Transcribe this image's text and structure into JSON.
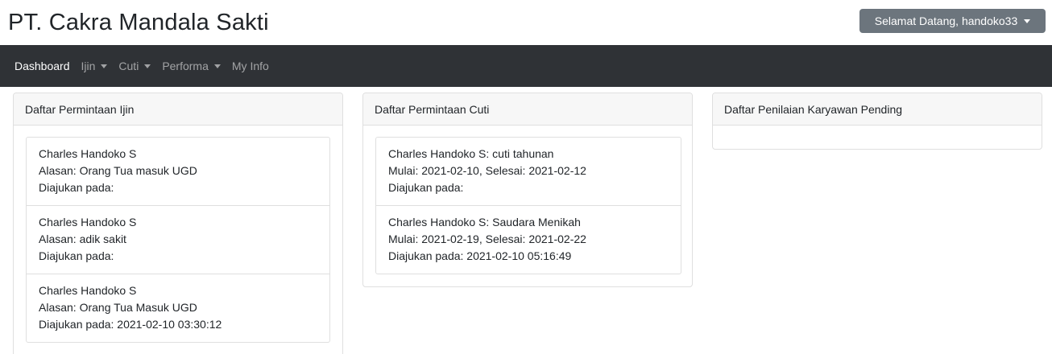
{
  "header": {
    "brand": "PT. Cakra Mandala Sakti",
    "user_menu_label": "Selamat Datang, handoko33"
  },
  "navbar": {
    "items": [
      {
        "label": "Dashboard"
      },
      {
        "label": "Ijin"
      },
      {
        "label": "Cuti"
      },
      {
        "label": "Performa"
      },
      {
        "label": "My Info"
      }
    ]
  },
  "ijin_panel": {
    "title": "Daftar Permintaan Ijin",
    "items": [
      {
        "name": "Charles Handoko S",
        "reason": "Alasan: Orang Tua masuk UGD",
        "submitted": "Diajukan pada:"
      },
      {
        "name": "Charles Handoko S",
        "reason": "Alasan: adik sakit",
        "submitted": "Diajukan pada:"
      },
      {
        "name": "Charles Handoko S",
        "reason": "Alasan: Orang Tua Masuk UGD",
        "submitted": "Diajukan pada: 2021-02-10 03:30:12"
      }
    ]
  },
  "cuti_panel": {
    "title": "Daftar Permintaan Cuti",
    "items": [
      {
        "title": "Charles Handoko S: cuti tahunan",
        "dates": "Mulai: 2021-02-10, Selesai: 2021-02-12",
        "submitted": "Diajukan pada:"
      },
      {
        "title": "Charles Handoko S: Saudara Menikah",
        "dates": "Mulai: 2021-02-19, Selesai: 2021-02-22",
        "submitted": "Diajukan pada: 2021-02-10 05:16:49"
      }
    ]
  },
  "penilaian_panel": {
    "title": "Daftar Penilaian Karyawan Pending"
  }
}
